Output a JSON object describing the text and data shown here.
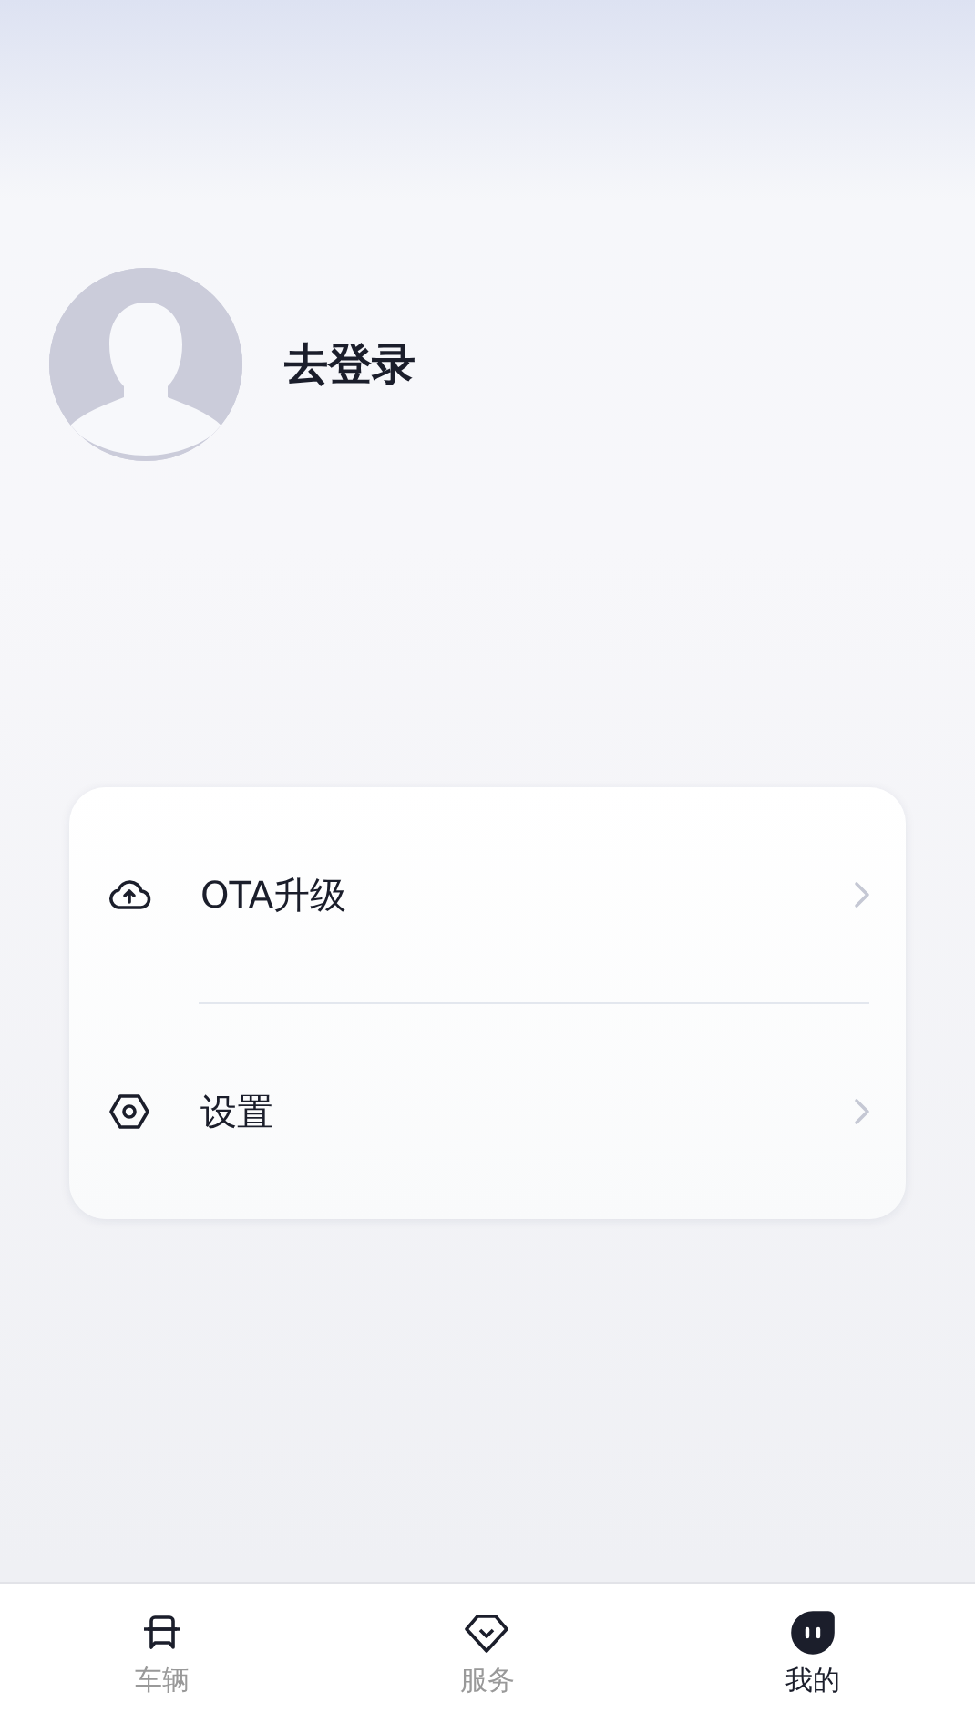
{
  "profile": {
    "login_label": "去登录"
  },
  "menu": [
    {
      "kind": "upload",
      "label": "OTA升级"
    },
    {
      "kind": "settings",
      "label": "设置"
    }
  ],
  "tabs": [
    {
      "kind": "car",
      "label": "车辆",
      "selected": false
    },
    {
      "kind": "service",
      "label": "服务",
      "selected": false
    },
    {
      "kind": "me",
      "label": "我的",
      "selected": true
    }
  ]
}
